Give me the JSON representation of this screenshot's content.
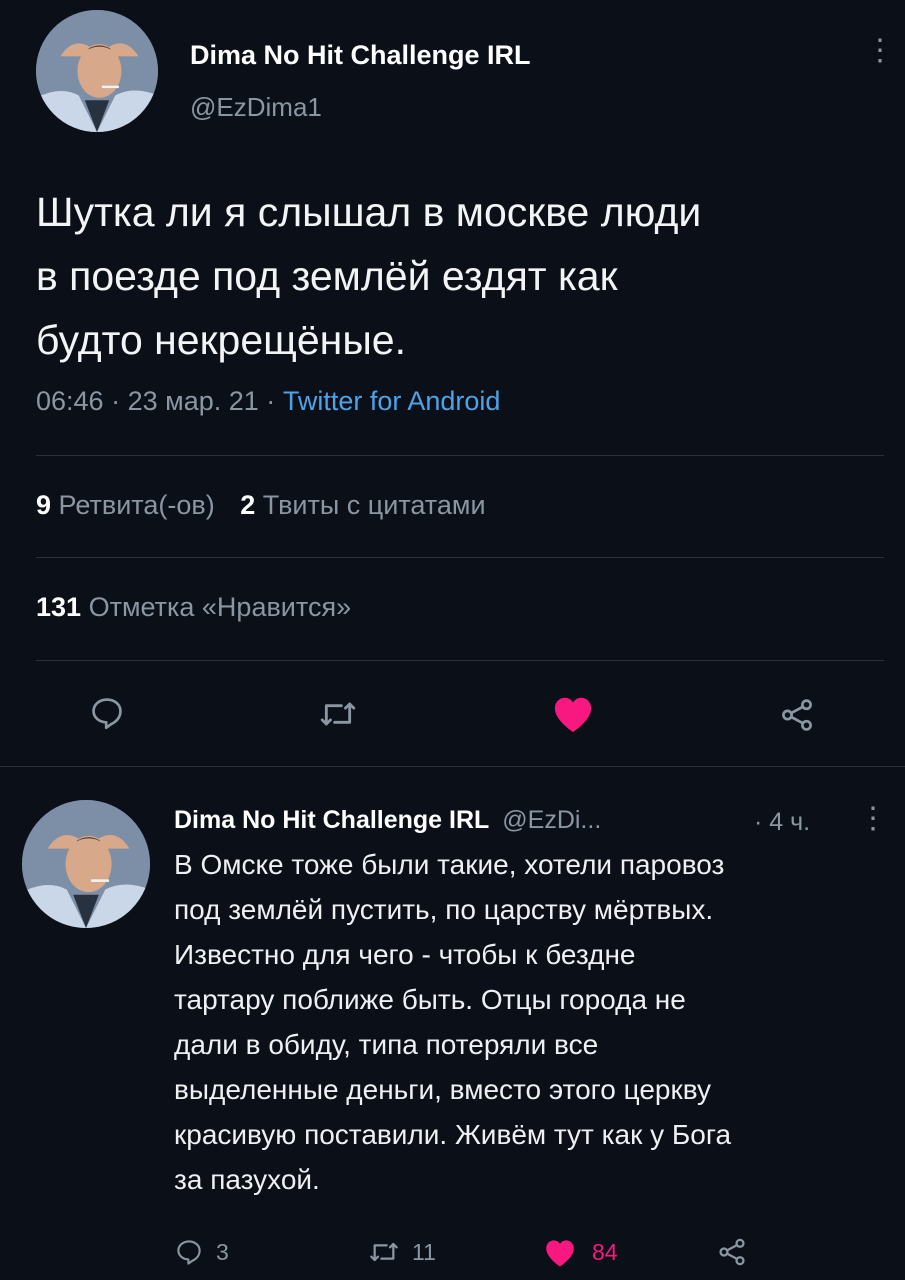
{
  "main_tweet": {
    "author_name": "Dima No Hit Challenge IRL",
    "author_handle": "@EzDima1",
    "text_lines": [
      "Шутка ли я слышал в москве люди",
      "в поезде под землёй ездят как",
      "будто некрещёные."
    ],
    "time": "06:46",
    "date": "23 мар. 21",
    "separator": "·",
    "source": "Twitter for Android",
    "retweets_count": "9",
    "retweets_label": "Ретвита(-ов)",
    "quotes_count": "2",
    "quotes_label": "Твиты с цитатами",
    "likes_count": "131",
    "likes_label": "Отметка «Нравится»",
    "more_glyph": "⋮"
  },
  "reply": {
    "author_name": "Dima No Hit Challenge IRL",
    "author_handle": "@EzDi...",
    "time": "· 4 ч.",
    "more_glyph": "⋮",
    "text_lines": [
      "В Омске тоже были такие, хотели паровоз",
      "под землёй пустить, по царству мёртвых.",
      "Известно для чего - чтобы к бездне",
      "тартару поближе быть. Отцы города не",
      "дали в обиду, типа потеряли все",
      "выделенные деньги, вместо этого церкву",
      "красивую поставили. Живём тут как у Бога",
      "за пазухой."
    ],
    "reply_count": "3",
    "retweet_count": "11",
    "like_count": "84"
  },
  "colors": {
    "background": "#0b0f18",
    "like_red": "#f91880",
    "link_blue": "#4ea3e8",
    "muted_gray": "#8b96a3"
  },
  "icons": [
    "reply-icon",
    "retweet-icon",
    "like-heart-icon",
    "share-icon"
  ]
}
